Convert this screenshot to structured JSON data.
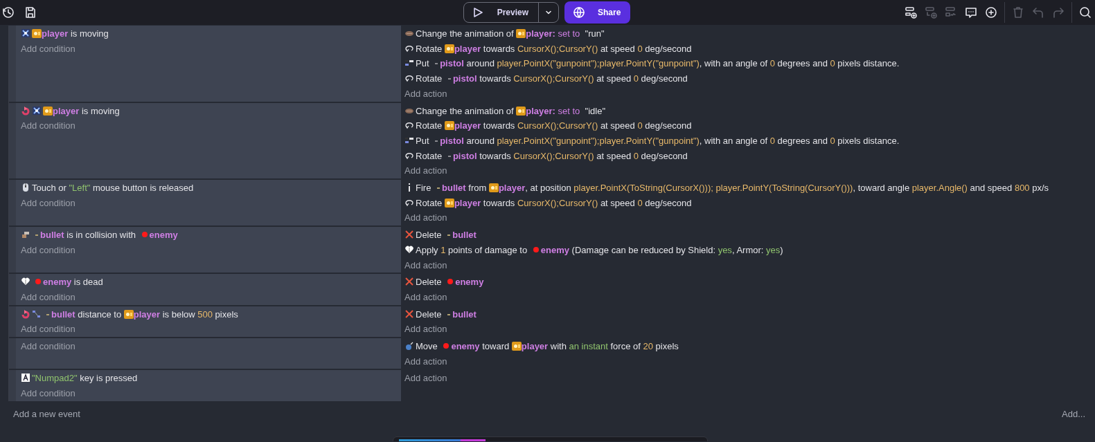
{
  "toolbar": {
    "left": [
      {
        "kind": "history"
      },
      {
        "kind": "save"
      }
    ],
    "preview": {
      "label": "Preview"
    },
    "share": {
      "label": "Share"
    },
    "right": [
      {
        "kind": "newevent",
        "disabled": false
      },
      {
        "kind": "subevent",
        "disabled": true
      },
      {
        "kind": "elseevent",
        "disabled": true
      },
      {
        "kind": "comment",
        "disabled": false
      },
      {
        "kind": "plus",
        "disabled": false
      },
      {
        "kind": "trash",
        "disabled": true
      },
      {
        "kind": "undo",
        "disabled": true
      },
      {
        "kind": "redo",
        "disabled": true
      },
      {
        "kind": "search",
        "disabled": false
      }
    ]
  },
  "events": [
    {
      "conditions": [
        {
          "icons": [
            {
              "kind": "move"
            }
          ],
          "parts": [
            {
              "kind": "player"
            },
            {
              "kind": "object",
              "text": "player"
            },
            {
              "kind": "text",
              "text": " is moving"
            }
          ]
        }
      ],
      "add_condition": "Add condition",
      "actions": [
        {
          "icons": [
            {
              "kind": "animation"
            }
          ],
          "parts": [
            {
              "kind": "text",
              "text": "Change the animation of "
            },
            {
              "kind": "player"
            },
            {
              "kind": "object",
              "text": "player:"
            },
            {
              "kind": "param",
              "text": " set to "
            },
            {
              "kind": "plain",
              "text": " \"run\""
            }
          ]
        },
        {
          "icons": [
            {
              "kind": "rotate"
            }
          ],
          "parts": [
            {
              "kind": "text",
              "text": "Rotate "
            },
            {
              "kind": "player"
            },
            {
              "kind": "object",
              "text": "player"
            },
            {
              "kind": "text",
              "text": " towards "
            },
            {
              "kind": "value",
              "text": "CursorX();CursorY()"
            },
            {
              "kind": "text",
              "text": " at speed "
            },
            {
              "kind": "value",
              "text": "0"
            },
            {
              "kind": "text",
              "text": " deg/second"
            }
          ]
        },
        {
          "icons": [
            {
              "kind": "put"
            }
          ],
          "parts": [
            {
              "kind": "text",
              "text": "Put "
            },
            {
              "kind": "pistol"
            },
            {
              "kind": "object",
              "text": "pistol"
            },
            {
              "kind": "text",
              "text": " around "
            },
            {
              "kind": "value",
              "text": "player.PointX(\"gunpoint\");player.PointY(\"gunpoint\")"
            },
            {
              "kind": "text",
              "text": ", with an angle of "
            },
            {
              "kind": "value",
              "text": "0"
            },
            {
              "kind": "text",
              "text": " degrees and "
            },
            {
              "kind": "value",
              "text": "0"
            },
            {
              "kind": "text",
              "text": " pixels distance."
            }
          ]
        },
        {
          "icons": [
            {
              "kind": "rotate"
            }
          ],
          "parts": [
            {
              "kind": "text",
              "text": "Rotate "
            },
            {
              "kind": "pistol"
            },
            {
              "kind": "object",
              "text": "pistol"
            },
            {
              "kind": "text",
              "text": " towards "
            },
            {
              "kind": "value",
              "text": "CursorX();CursorY()"
            },
            {
              "kind": "text",
              "text": " at speed "
            },
            {
              "kind": "value",
              "text": "0"
            },
            {
              "kind": "text",
              "text": " deg/second"
            }
          ]
        }
      ],
      "add_action": "Add action"
    },
    {
      "conditions": [
        {
          "icons": [
            {
              "kind": "invert"
            },
            {
              "kind": "move"
            }
          ],
          "parts": [
            {
              "kind": "player"
            },
            {
              "kind": "object",
              "text": "player"
            },
            {
              "kind": "text",
              "text": " is moving"
            }
          ]
        }
      ],
      "add_condition": "Add condition",
      "actions": [
        {
          "icons": [
            {
              "kind": "animation"
            }
          ],
          "parts": [
            {
              "kind": "text",
              "text": "Change the animation of "
            },
            {
              "kind": "player"
            },
            {
              "kind": "object",
              "text": "player:"
            },
            {
              "kind": "param",
              "text": " set to "
            },
            {
              "kind": "plain",
              "text": " \"idle\""
            }
          ]
        },
        {
          "icons": [
            {
              "kind": "rotate"
            }
          ],
          "parts": [
            {
              "kind": "text",
              "text": "Rotate "
            },
            {
              "kind": "player"
            },
            {
              "kind": "object",
              "text": "player"
            },
            {
              "kind": "text",
              "text": " towards "
            },
            {
              "kind": "value",
              "text": "CursorX();CursorY()"
            },
            {
              "kind": "text",
              "text": " at speed "
            },
            {
              "kind": "value",
              "text": "0"
            },
            {
              "kind": "text",
              "text": " deg/second"
            }
          ]
        },
        {
          "icons": [
            {
              "kind": "put"
            }
          ],
          "parts": [
            {
              "kind": "text",
              "text": "Put "
            },
            {
              "kind": "pistol"
            },
            {
              "kind": "object",
              "text": "pistol"
            },
            {
              "kind": "text",
              "text": " around "
            },
            {
              "kind": "value",
              "text": "player.PointX(\"gunpoint\");player.PointY(\"gunpoint\")"
            },
            {
              "kind": "text",
              "text": ", with an angle of "
            },
            {
              "kind": "value",
              "text": "0"
            },
            {
              "kind": "text",
              "text": " degrees and "
            },
            {
              "kind": "value",
              "text": "0"
            },
            {
              "kind": "text",
              "text": " pixels distance."
            }
          ]
        },
        {
          "icons": [
            {
              "kind": "rotate"
            }
          ],
          "parts": [
            {
              "kind": "text",
              "text": "Rotate "
            },
            {
              "kind": "pistol"
            },
            {
              "kind": "object",
              "text": "pistol"
            },
            {
              "kind": "text",
              "text": " towards "
            },
            {
              "kind": "value",
              "text": "CursorX();CursorY()"
            },
            {
              "kind": "text",
              "text": " at speed "
            },
            {
              "kind": "value",
              "text": "0"
            },
            {
              "kind": "text",
              "text": " deg/second"
            }
          ]
        }
      ],
      "add_action": "Add action"
    },
    {
      "conditions": [
        {
          "icons": [
            {
              "kind": "mouse"
            }
          ],
          "parts": [
            {
              "kind": "text",
              "text": "Touch or "
            },
            {
              "kind": "string",
              "text": "\"Left\""
            },
            {
              "kind": "text",
              "text": " mouse button is released"
            }
          ]
        }
      ],
      "add_condition": "Add condition",
      "actions": [
        {
          "icons": [
            {
              "kind": "fire"
            }
          ],
          "parts": [
            {
              "kind": "text",
              "text": "Fire "
            },
            {
              "kind": "bullet"
            },
            {
              "kind": "object",
              "text": "bullet"
            },
            {
              "kind": "text",
              "text": " from "
            },
            {
              "kind": "player"
            },
            {
              "kind": "object",
              "text": "player"
            },
            {
              "kind": "text",
              "text": ", at position "
            },
            {
              "kind": "value",
              "text": "player.PointX(ToString(CursorX())); player.PointY(ToString(CursorY()))"
            },
            {
              "kind": "text",
              "text": ", toward angle "
            },
            {
              "kind": "value",
              "text": "player.Angle()"
            },
            {
              "kind": "text",
              "text": " and speed "
            },
            {
              "kind": "value",
              "text": "800"
            },
            {
              "kind": "text",
              "text": " px/s"
            }
          ]
        },
        {
          "icons": [
            {
              "kind": "rotate"
            }
          ],
          "parts": [
            {
              "kind": "text",
              "text": "Rotate "
            },
            {
              "kind": "player"
            },
            {
              "kind": "object",
              "text": "player"
            },
            {
              "kind": "text",
              "text": " towards "
            },
            {
              "kind": "value",
              "text": "CursorX();CursorY()"
            },
            {
              "kind": "text",
              "text": " at speed "
            },
            {
              "kind": "value",
              "text": "0"
            },
            {
              "kind": "text",
              "text": " deg/second"
            }
          ]
        }
      ],
      "add_action": "Add action"
    },
    {
      "conditions": [
        {
          "icons": [
            {
              "kind": "collision"
            }
          ],
          "parts": [
            {
              "kind": "bullet"
            },
            {
              "kind": "object",
              "text": "bullet"
            },
            {
              "kind": "text",
              "text": " is in collision with "
            },
            {
              "kind": "enemy"
            },
            {
              "kind": "object",
              "text": "enemy"
            }
          ]
        }
      ],
      "add_condition": "Add condition",
      "actions": [
        {
          "icons": [
            {
              "kind": "delete"
            }
          ],
          "parts": [
            {
              "kind": "text",
              "text": "Delete "
            },
            {
              "kind": "bullet"
            },
            {
              "kind": "object",
              "text": "bullet"
            }
          ]
        },
        {
          "icons": [
            {
              "kind": "health"
            }
          ],
          "parts": [
            {
              "kind": "text",
              "text": "Apply "
            },
            {
              "kind": "value",
              "text": "1"
            },
            {
              "kind": "text",
              "text": " points of damage to "
            },
            {
              "kind": "enemy"
            },
            {
              "kind": "object",
              "text": "enemy"
            },
            {
              "kind": "text",
              "text": " (Damage can be reduced by Shield: "
            },
            {
              "kind": "string",
              "text": "yes"
            },
            {
              "kind": "text",
              "text": ", Armor: "
            },
            {
              "kind": "string",
              "text": "yes"
            },
            {
              "kind": "text",
              "text": ")"
            }
          ]
        }
      ],
      "add_action": "Add action"
    },
    {
      "conditions": [
        {
          "icons": [
            {
              "kind": "health"
            }
          ],
          "parts": [
            {
              "kind": "enemy"
            },
            {
              "kind": "object",
              "text": "enemy"
            },
            {
              "kind": "text",
              "text": " is dead"
            }
          ]
        }
      ],
      "add_condition": "Add condition",
      "actions": [
        {
          "icons": [
            {
              "kind": "delete"
            }
          ],
          "parts": [
            {
              "kind": "text",
              "text": "Delete "
            },
            {
              "kind": "enemy"
            },
            {
              "kind": "object",
              "text": "enemy"
            }
          ]
        }
      ],
      "add_action": "Add action"
    },
    {
      "conditions": [
        {
          "icons": [
            {
              "kind": "invert"
            },
            {
              "kind": "distance"
            }
          ],
          "parts": [
            {
              "kind": "bullet"
            },
            {
              "kind": "object",
              "text": "bullet"
            },
            {
              "kind": "text",
              "text": " distance to "
            },
            {
              "kind": "player"
            },
            {
              "kind": "object",
              "text": "player"
            },
            {
              "kind": "text",
              "text": " is below "
            },
            {
              "kind": "value",
              "text": "500"
            },
            {
              "kind": "text",
              "text": " pixels"
            }
          ]
        }
      ],
      "add_condition": "Add condition",
      "actions": [
        {
          "icons": [
            {
              "kind": "delete"
            }
          ],
          "parts": [
            {
              "kind": "text",
              "text": "Delete "
            },
            {
              "kind": "bullet"
            },
            {
              "kind": "object",
              "text": "bullet"
            }
          ]
        }
      ],
      "add_action": "Add action"
    },
    {
      "add_condition": "Add condition",
      "actions": [
        {
          "icons": [
            {
              "kind": "force"
            }
          ],
          "parts": [
            {
              "kind": "text",
              "text": "Move "
            },
            {
              "kind": "enemy"
            },
            {
              "kind": "object",
              "text": "enemy"
            },
            {
              "kind": "text",
              "text": " toward "
            },
            {
              "kind": "player"
            },
            {
              "kind": "object",
              "text": "player"
            },
            {
              "kind": "text",
              "text": " with "
            },
            {
              "kind": "string",
              "text": "an instant"
            },
            {
              "kind": "text",
              "text": " force of "
            },
            {
              "kind": "value",
              "text": "20"
            },
            {
              "kind": "text",
              "text": " pixels"
            }
          ]
        }
      ],
      "add_action": "Add action"
    },
    {
      "conditions": [
        {
          "icons": [
            {
              "kind": "keyboard"
            }
          ],
          "parts": [
            {
              "kind": "string",
              "text": "\"Numpad2\""
            },
            {
              "kind": "text",
              "text": " key is pressed"
            }
          ]
        }
      ],
      "add_condition": "Add condition",
      "add_action": "Add action"
    }
  ],
  "footer": {
    "add_event": "Add a new event",
    "add_other": "Add..."
  }
}
